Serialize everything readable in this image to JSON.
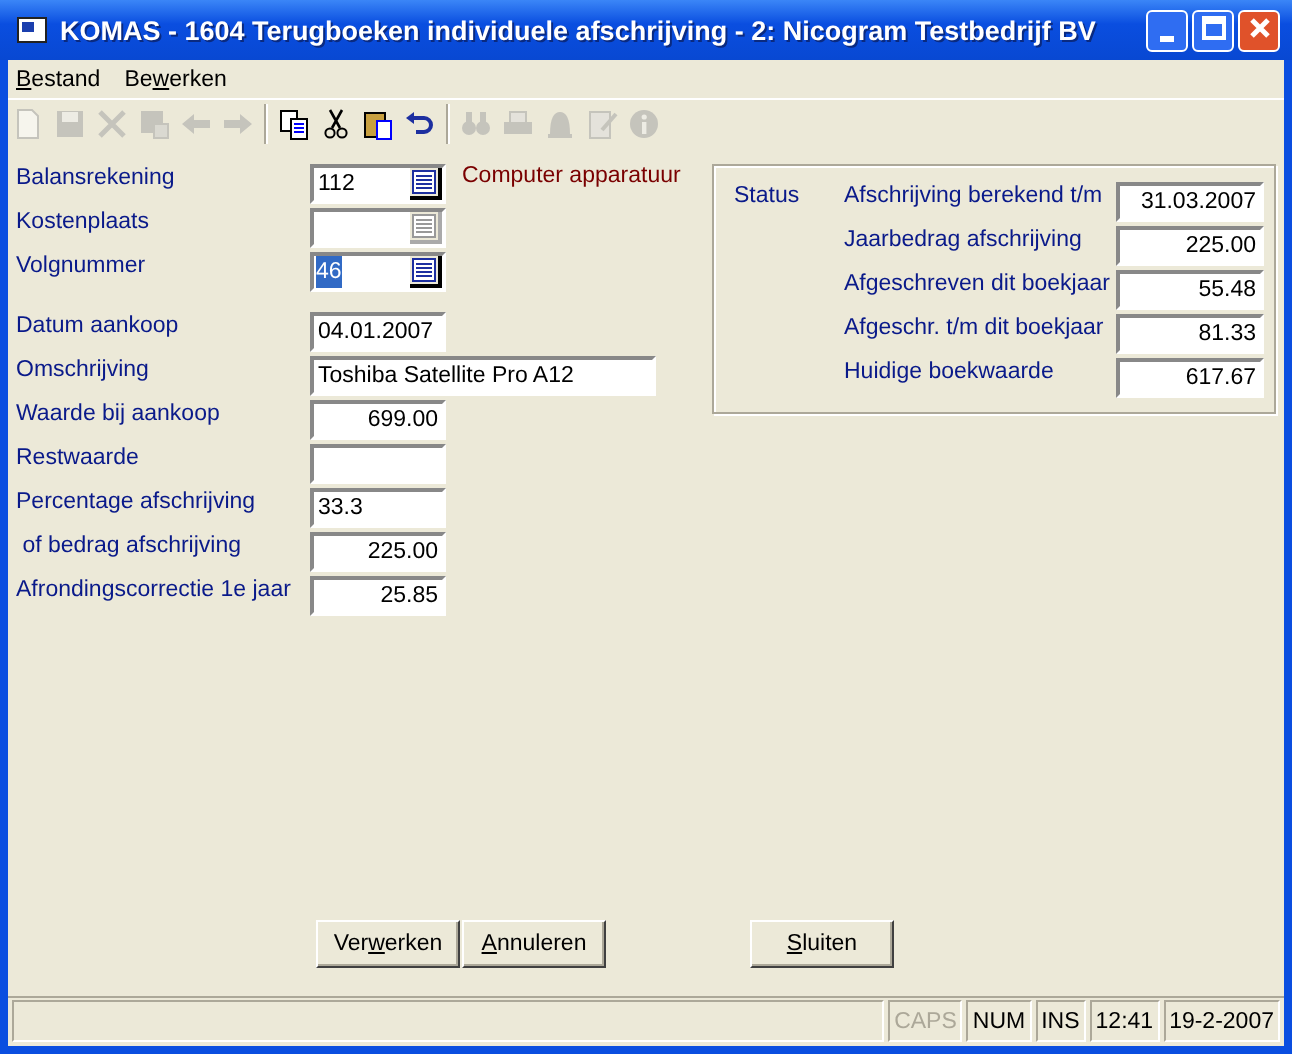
{
  "window": {
    "title": "KOMAS - 1604 Terugboeken individuele afschrijving - 2: Nicogram Testbedrijf BV"
  },
  "menu": [
    {
      "key": "B",
      "post": "estand"
    },
    {
      "pre": "Be",
      "key": "w",
      "post": "erken"
    }
  ],
  "toolbar": [
    {
      "kind": "new",
      "disabled": true
    },
    {
      "kind": "save",
      "disabled": true
    },
    {
      "kind": "delete",
      "disabled": true
    },
    {
      "kind": "save-as",
      "disabled": true
    },
    {
      "kind": "back",
      "disabled": true
    },
    {
      "kind": "forward",
      "disabled": true
    },
    {
      "kind": "separator"
    },
    {
      "kind": "copy",
      "disabled": false
    },
    {
      "kind": "cut",
      "disabled": false
    },
    {
      "kind": "paste",
      "disabled": false
    },
    {
      "kind": "undo",
      "disabled": false
    },
    {
      "kind": "separator"
    },
    {
      "kind": "find",
      "disabled": true
    },
    {
      "kind": "print",
      "disabled": true
    },
    {
      "kind": "bell",
      "disabled": true
    },
    {
      "kind": "note",
      "disabled": true
    },
    {
      "kind": "info",
      "disabled": true
    }
  ],
  "account_fields": [
    {
      "label": "Balansrekening",
      "value": "112",
      "lookup": {
        "disabled": false
      },
      "description": "Computer apparatuur",
      "selected": false
    },
    {
      "label": "Kostenplaats",
      "lookup": {
        "disabled": true
      },
      "selected": false
    },
    {
      "label": "Volgnummer",
      "value": "46",
      "lookup": {
        "disabled": false
      },
      "selected": true
    }
  ],
  "asset_fields": [
    {
      "label": "Datum aankoop",
      "value": "04.01.2007",
      "kind": "text"
    },
    {
      "label": "Omschrijving",
      "value": "Toshiba Satellite Pro A12",
      "kind": "long-text"
    },
    {
      "label": "Waarde bij aankoop",
      "value": "699.00",
      "kind": "number"
    },
    {
      "label": "Restwaarde",
      "kind": "number"
    },
    {
      "label": "Percentage afschrijving",
      "value": "33.3",
      "kind": "text"
    },
    {
      "label": " of bedrag afschrijving",
      "value": "225.00",
      "kind": "number"
    },
    {
      "label": "Afrondingscorrectie 1e jaar",
      "value": "25.85",
      "kind": "number"
    }
  ],
  "status_panel": {
    "title": "Status",
    "rows": [
      {
        "label": "Afschrijving berekend t/m",
        "value": "31.03.2007"
      },
      {
        "label": "Jaarbedrag afschrijving",
        "value": "225.00"
      },
      {
        "label": "Afgeschreven dit boekjaar",
        "value": "55.48"
      },
      {
        "label": "Afgeschr. t/m dit boekjaar",
        "value": "81.33"
      },
      {
        "label": "Huidige boekwaarde",
        "value": "617.67"
      }
    ]
  },
  "button_groups": [
    [
      {
        "pre": "Ver",
        "key": "w",
        "post": "erken"
      },
      {
        "key": "A",
        "post": "nnuleren"
      }
    ],
    [
      {
        "key": "S",
        "post": "luiten"
      }
    ]
  ],
  "status_bar": [
    {
      "text": "CAPS",
      "disabled": true
    },
    {
      "text": "NUM",
      "disabled": false
    },
    {
      "text": "INS",
      "disabled": false
    },
    {
      "text": "12:41",
      "disabled": false
    },
    {
      "text": "19-2-2007",
      "disabled": false
    }
  ]
}
